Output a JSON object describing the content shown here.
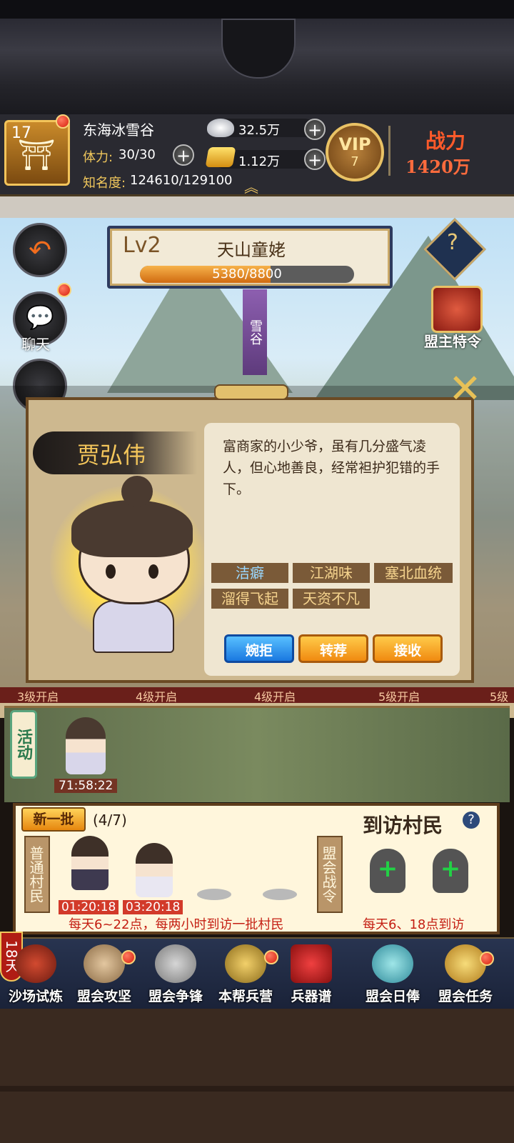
{
  "player": {
    "level": "17",
    "name": "东海冰雪谷",
    "stamina_label": "体力:",
    "stamina": "30/30",
    "fame_label": "知名度:",
    "fame": "124610/129100"
  },
  "resources": {
    "silver": "32.5万",
    "gold": "1.12万"
  },
  "vip": {
    "text": "VIP",
    "level": "7"
  },
  "power": {
    "title": "战力",
    "value": "1420万"
  },
  "alliance": {
    "level": "Lv2",
    "name": "天山童姥",
    "exp": "5380/8800",
    "exp_fraction": 0.611,
    "banner": "雪谷"
  },
  "left_buttons": {
    "chat": "聊天"
  },
  "right_buttons": {
    "decree": "盟主特令"
  },
  "npc": {
    "name": "贾弘伟",
    "description": "富商家的小少爷，虽有几分盛气凌人，但心地善良，经常袒护犯错的手下。",
    "tags": [
      "洁癖",
      "江湖味",
      "塞北血统",
      "溜得飞起",
      "天资不凡"
    ],
    "buttons": {
      "reject": "婉拒",
      "recommend": "转荐",
      "accept": "接收"
    }
  },
  "unlocks": [
    "3级开启",
    "4级开启",
    "4级开启",
    "5级开启",
    "5级"
  ],
  "activity": {
    "tag": "活动",
    "timer": "71:58:22"
  },
  "visit": {
    "new_batch": "新一批",
    "count": "(4/7)",
    "title": "到访村民",
    "help": "?",
    "normal_tag": "普通村民",
    "alliance_tag": "盟会战令",
    "timers": [
      "01:20:18",
      "03:20:18"
    ],
    "normal_note": "每天6~22点，每两小时到访一批村民",
    "alliance_note": "每天6、18点到访",
    "plus": "+"
  },
  "nav": {
    "days": "18天",
    "items": [
      "沙场试炼",
      "盟会攻坚",
      "盟会争锋",
      "本帮兵营",
      "兵器谱",
      "盟会日俸",
      "盟会任务"
    ]
  },
  "colors": {
    "accent": "#f0c75c",
    "alert": "#c41e12",
    "nav_bg": "#283450"
  }
}
